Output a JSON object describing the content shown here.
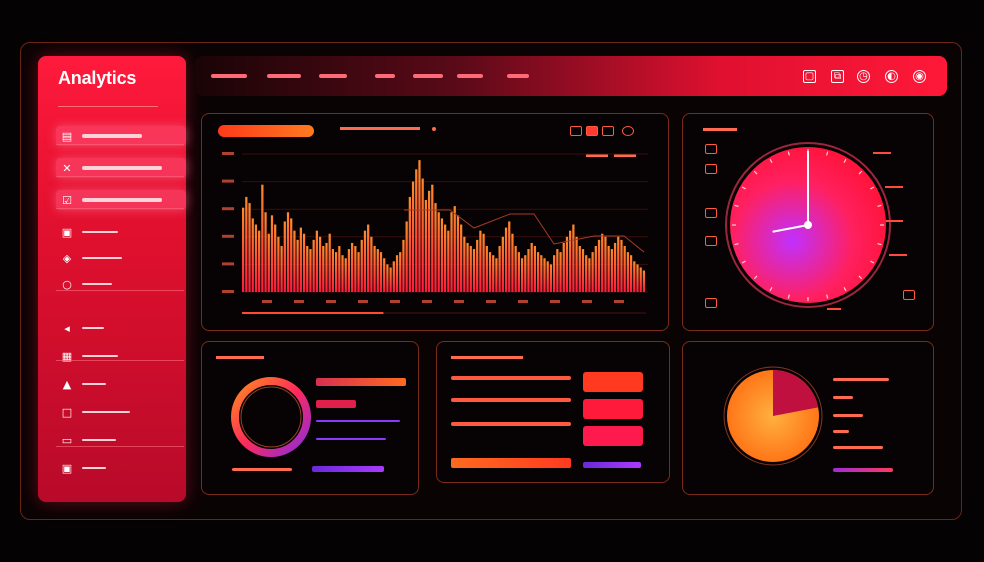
{
  "app": {
    "title": "Analytics"
  },
  "colors": {
    "accent": "#ff1a3c",
    "accent_orange": "#ff6a1a",
    "accent_purple": "#8a2be2",
    "panel_border": "#7a2a1a",
    "background": "#050203"
  },
  "sidebar": {
    "items": [
      {
        "icon": "calendar-icon",
        "active": true
      },
      {
        "icon": "cross-tool-icon",
        "active": true
      },
      {
        "icon": "checkbox-icon",
        "active": true
      },
      {
        "icon": "lock-icon",
        "active": false
      },
      {
        "icon": "shield-icon",
        "active": false
      },
      {
        "icon": "circle-icon",
        "active": false
      },
      {
        "icon": "arrow-icon",
        "active": false
      },
      {
        "icon": "grid-icon",
        "active": false
      },
      {
        "icon": "triangle-icon",
        "active": false
      },
      {
        "icon": "square-icon",
        "active": false
      },
      {
        "icon": "printer-icon",
        "active": false
      },
      {
        "icon": "image-icon",
        "active": false
      }
    ]
  },
  "topbar": {
    "nav_items": 7,
    "icons": [
      "window-icon",
      "copy-icon",
      "clock-icon",
      "globe-icon",
      "user-icon"
    ]
  },
  "bar_chart": {
    "dropdown_icon": "chevron-down-icon",
    "progress": 0.35
  },
  "chart_data": {
    "type": "bar",
    "series": [
      {
        "values": [
          55,
          62,
          58,
          48,
          44,
          40,
          70,
          52,
          38,
          50,
          44,
          36,
          30,
          46,
          52,
          48,
          40,
          34,
          42,
          38,
          30,
          28,
          34,
          40,
          36,
          30,
          32,
          38,
          28,
          26,
          30,
          24,
          22,
          28,
          32,
          30,
          26,
          34,
          40,
          44,
          36,
          30,
          28,
          26,
          22,
          18,
          16,
          20,
          24,
          26,
          34,
          46,
          62,
          72,
          80,
          86,
          74,
          60,
          66,
          70,
          58,
          52,
          48,
          44,
          40,
          52,
          56,
          50,
          44,
          36,
          32,
          30,
          28,
          34,
          40,
          38,
          30,
          26,
          24,
          22,
          30,
          36,
          42,
          46,
          38,
          30,
          26,
          22,
          24,
          28,
          32,
          30,
          26,
          24,
          22,
          20,
          18,
          24,
          28,
          26,
          32,
          36,
          40,
          44,
          36,
          30,
          28,
          24,
          22,
          26,
          30,
          34,
          38,
          36,
          30,
          28,
          32,
          36,
          34,
          30,
          26,
          24,
          20,
          18,
          16,
          14
        ]
      }
    ]
  },
  "gauge": {
    "value": 0.2
  },
  "donut": {
    "progress": 0.6
  },
  "pie": {
    "slice": 0.22
  },
  "metrics": {
    "buttons": 3,
    "rows": 4
  }
}
